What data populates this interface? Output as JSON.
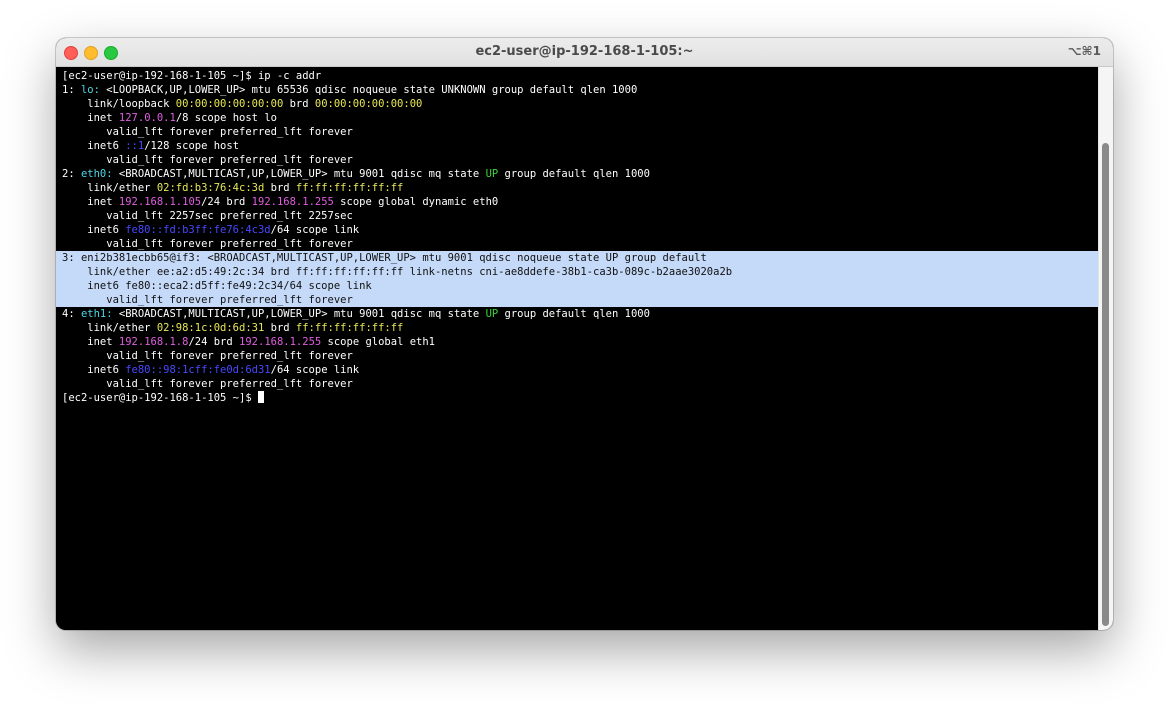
{
  "window": {
    "title": "ec2-user@ip-192-168-1-105:~",
    "shortcut": "⌥⌘1"
  },
  "colors": {
    "default": "#ffffff",
    "cyan": "#4fd6e6",
    "yellow": "#e7e756",
    "magenta": "#e05ee0",
    "blue": "#4848ff",
    "green": "#3ad33a",
    "selection_text": "#111111",
    "selection_bg": "#c5d9f8"
  },
  "terminal": {
    "lines": [
      {
        "selected": false,
        "segments": [
          {
            "text": "[ec2-user@ip-192-168-1-105 ~]$ ip -c addr",
            "color": "default"
          }
        ]
      },
      {
        "selected": false,
        "segments": [
          {
            "text": "1: ",
            "color": "default"
          },
          {
            "text": "lo:",
            "color": "cyan"
          },
          {
            "text": " <LOOPBACK,UP,LOWER_UP> mtu 65536 qdisc noqueue state UNKNOWN group default qlen 1000",
            "color": "default"
          }
        ]
      },
      {
        "selected": false,
        "segments": [
          {
            "text": "    link/loopback ",
            "color": "default"
          },
          {
            "text": "00:00:00:00:00:00",
            "color": "yellow"
          },
          {
            "text": " brd ",
            "color": "default"
          },
          {
            "text": "00:00:00:00:00:00",
            "color": "yellow"
          }
        ]
      },
      {
        "selected": false,
        "segments": [
          {
            "text": "    inet ",
            "color": "default"
          },
          {
            "text": "127.0.0.1",
            "color": "magenta"
          },
          {
            "text": "/8 scope host lo",
            "color": "default"
          }
        ]
      },
      {
        "selected": false,
        "segments": [
          {
            "text": "       valid_lft forever preferred_lft forever",
            "color": "default"
          }
        ]
      },
      {
        "selected": false,
        "segments": [
          {
            "text": "    inet6 ",
            "color": "default"
          },
          {
            "text": "::1",
            "color": "blue"
          },
          {
            "text": "/128 scope host",
            "color": "default"
          }
        ]
      },
      {
        "selected": false,
        "segments": [
          {
            "text": "       valid_lft forever preferred_lft forever",
            "color": "default"
          }
        ]
      },
      {
        "selected": false,
        "segments": [
          {
            "text": "2: ",
            "color": "default"
          },
          {
            "text": "eth0:",
            "color": "cyan"
          },
          {
            "text": " <BROADCAST,MULTICAST,UP,LOWER_UP> mtu 9001 qdisc mq state ",
            "color": "default"
          },
          {
            "text": "UP",
            "color": "green"
          },
          {
            "text": " group default qlen 1000",
            "color": "default"
          }
        ]
      },
      {
        "selected": false,
        "segments": [
          {
            "text": "    link/ether ",
            "color": "default"
          },
          {
            "text": "02:fd:b3:76:4c:3d",
            "color": "yellow"
          },
          {
            "text": " brd ",
            "color": "default"
          },
          {
            "text": "ff:ff:ff:ff:ff:ff",
            "color": "yellow"
          }
        ]
      },
      {
        "selected": false,
        "segments": [
          {
            "text": "    inet ",
            "color": "default"
          },
          {
            "text": "192.168.1.105",
            "color": "magenta"
          },
          {
            "text": "/24 brd ",
            "color": "default"
          },
          {
            "text": "192.168.1.255",
            "color": "magenta"
          },
          {
            "text": " scope global dynamic eth0",
            "color": "default"
          }
        ]
      },
      {
        "selected": false,
        "segments": [
          {
            "text": "       valid_lft 2257sec preferred_lft 2257sec",
            "color": "default"
          }
        ]
      },
      {
        "selected": false,
        "segments": [
          {
            "text": "    inet6 ",
            "color": "default"
          },
          {
            "text": "fe80::fd:b3ff:fe76:4c3d",
            "color": "blue"
          },
          {
            "text": "/64 scope link",
            "color": "default"
          }
        ]
      },
      {
        "selected": false,
        "segments": [
          {
            "text": "       valid_lft forever preferred_lft forever",
            "color": "default"
          }
        ]
      },
      {
        "selected": true,
        "segments": [
          {
            "text": "3: eni2b381ecbb65@if3: <BROADCAST,MULTICAST,UP,LOWER_UP> mtu 9001 qdisc noqueue state UP group default",
            "color": "default"
          }
        ]
      },
      {
        "selected": true,
        "segments": [
          {
            "text": "    link/ether ee:a2:d5:49:2c:34 brd ff:ff:ff:ff:ff:ff link-netns cni-ae8ddefe-38b1-ca3b-089c-b2aae3020a2b",
            "color": "default"
          }
        ]
      },
      {
        "selected": true,
        "segments": [
          {
            "text": "    inet6 fe80::eca2:d5ff:fe49:2c34/64 scope link",
            "color": "default"
          }
        ]
      },
      {
        "selected": true,
        "segments": [
          {
            "text": "       valid_lft forever preferred_lft forever",
            "color": "default"
          }
        ]
      },
      {
        "selected": false,
        "segments": [
          {
            "text": "4: ",
            "color": "default"
          },
          {
            "text": "eth1:",
            "color": "cyan"
          },
          {
            "text": " <BROADCAST,MULTICAST,UP,LOWER_UP> mtu 9001 qdisc mq state ",
            "color": "default"
          },
          {
            "text": "UP",
            "color": "green"
          },
          {
            "text": " group default qlen 1000",
            "color": "default"
          }
        ]
      },
      {
        "selected": false,
        "segments": [
          {
            "text": "    link/ether ",
            "color": "default"
          },
          {
            "text": "02:98:1c:0d:6d:31",
            "color": "yellow"
          },
          {
            "text": " brd ",
            "color": "default"
          },
          {
            "text": "ff:ff:ff:ff:ff:ff",
            "color": "yellow"
          }
        ]
      },
      {
        "selected": false,
        "segments": [
          {
            "text": "    inet ",
            "color": "default"
          },
          {
            "text": "192.168.1.8",
            "color": "magenta"
          },
          {
            "text": "/24 brd ",
            "color": "default"
          },
          {
            "text": "192.168.1.255",
            "color": "magenta"
          },
          {
            "text": " scope global eth1",
            "color": "default"
          }
        ]
      },
      {
        "selected": false,
        "segments": [
          {
            "text": "       valid_lft forever preferred_lft forever",
            "color": "default"
          }
        ]
      },
      {
        "selected": false,
        "segments": [
          {
            "text": "    inet6 ",
            "color": "default"
          },
          {
            "text": "fe80::98:1cff:fe0d:6d31",
            "color": "blue"
          },
          {
            "text": "/64 scope link",
            "color": "default"
          }
        ]
      },
      {
        "selected": false,
        "segments": [
          {
            "text": "       valid_lft forever preferred_lft forever",
            "color": "default"
          }
        ]
      }
    ],
    "prompt": "[ec2-user@ip-192-168-1-105 ~]$ "
  }
}
